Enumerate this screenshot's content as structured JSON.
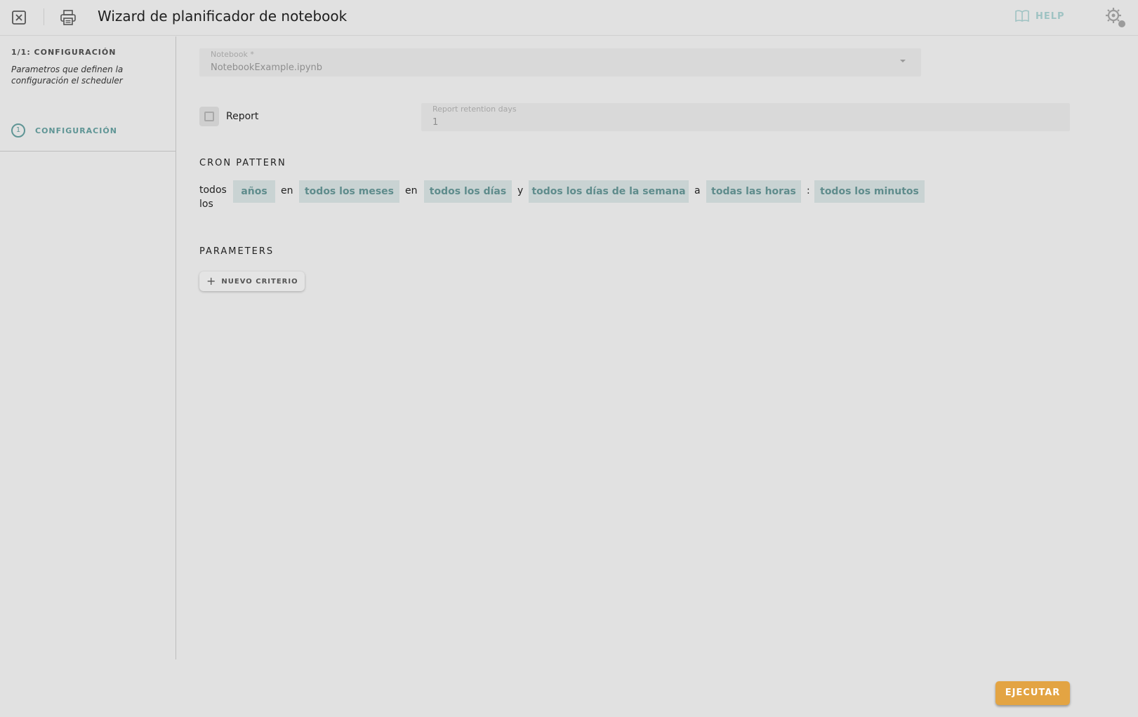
{
  "header": {
    "title": "Wizard de planificador de notebook",
    "help_label": "HELP"
  },
  "sidebar": {
    "step_title": "1/1: CONFIGURACIÓN",
    "step_description": "Parametros que definen la configuración el scheduler",
    "steps": [
      {
        "number": "1",
        "label": "CONFIGURACIÓN"
      }
    ]
  },
  "form": {
    "notebook": {
      "label": "Notebook *",
      "value": "NotebookExample.ipynb"
    },
    "report": {
      "label": "Report",
      "checked": false
    },
    "retention": {
      "label": "Report retention days",
      "value": "1"
    }
  },
  "cron": {
    "heading": "CRON PATTERN",
    "prefix": "todos los",
    "years": "años",
    "sep1": "en",
    "months": "todos los meses",
    "sep2": "en",
    "days": "todos los días",
    "sep3": "y",
    "weekdays": "todos los días de la semana",
    "sep4": "a",
    "hours": "todas las horas",
    "sep5": ":",
    "minutes": "todos los minutos"
  },
  "parameters": {
    "heading": "PARAMETERS",
    "new_criterion": "NUEVO CRITERIO"
  },
  "footer": {
    "run_label": "EJECUTAR"
  },
  "colors": {
    "accent": "#5f9595",
    "chip_bg": "#c9d3d3",
    "run_button": "#e3a443",
    "help": "#9fc3c3"
  },
  "icons": {
    "close": "close-icon",
    "print": "printer-icon",
    "help": "book-icon",
    "user": "user-settings-icon"
  }
}
